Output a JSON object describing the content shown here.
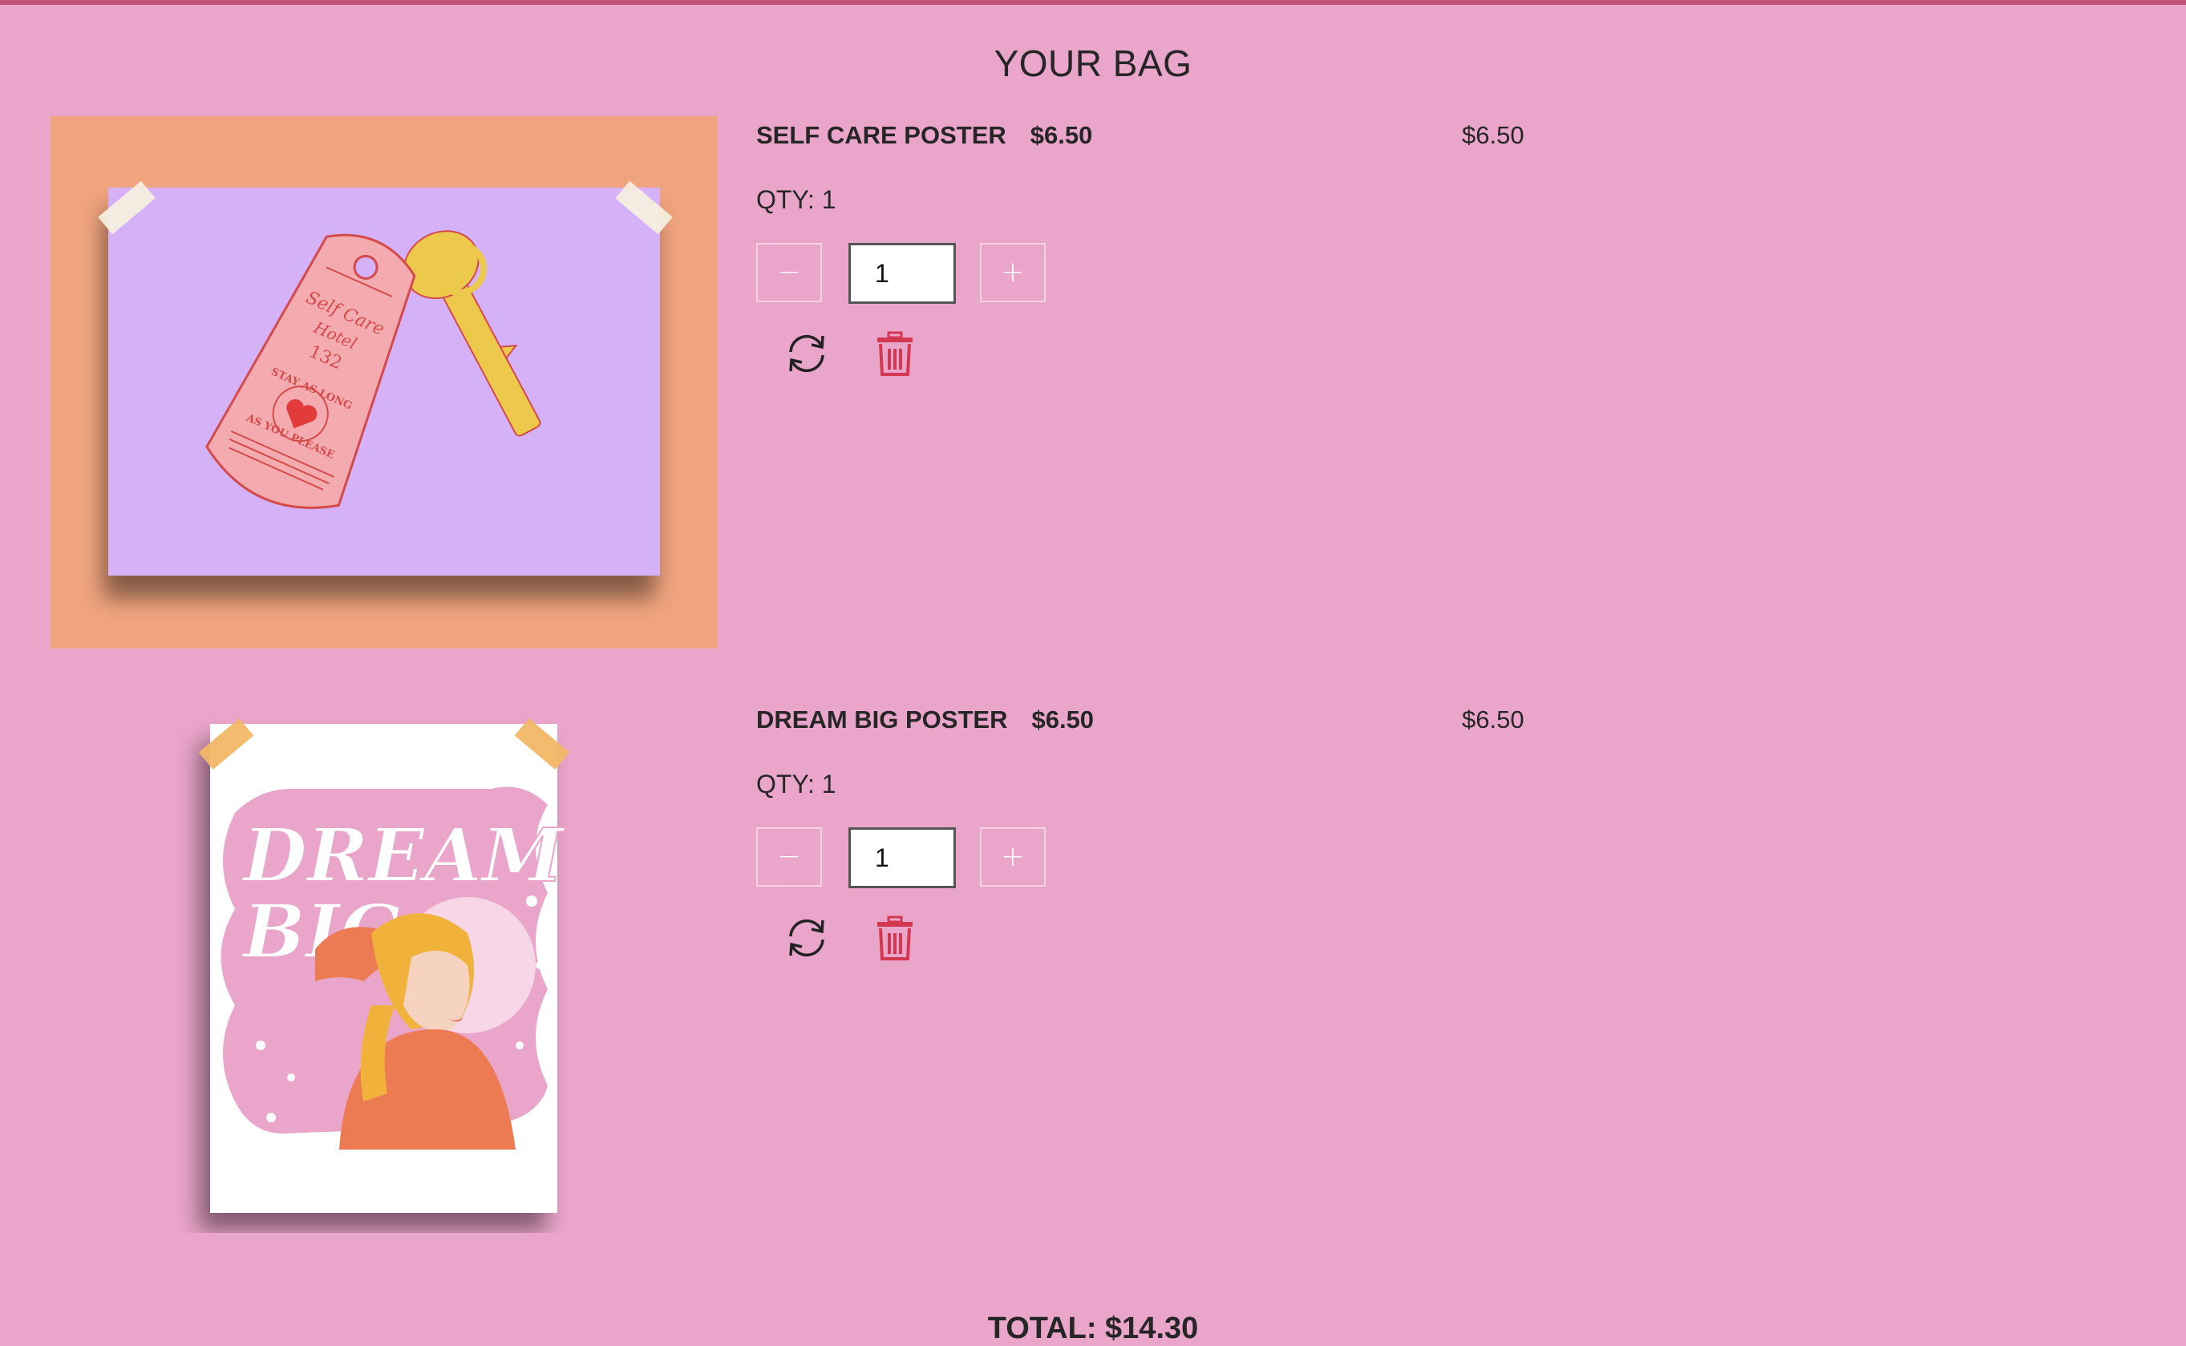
{
  "page": {
    "title": "YOUR BAG",
    "total": "TOTAL: $14.30"
  },
  "colors": {
    "background": "#eaa5ca",
    "accent_bar": "#c0527a",
    "delete_icon": "#d2384f"
  },
  "items": [
    {
      "name": "SELF CARE POSTER",
      "price": "$6.50",
      "line_total": "$6.50",
      "qty_label": "QTY: 1",
      "qty_value": "1",
      "minus_label": "−",
      "plus_label": "+",
      "image": {
        "keytag_text": [
          "Self Care",
          "Hotel",
          "132",
          "STAY AS LONG",
          "AS YOU PLEASE"
        ]
      }
    },
    {
      "name": "DREAM BIG POSTER",
      "price": "$6.50",
      "line_total": "$6.50",
      "qty_label": "QTY: 1",
      "qty_value": "1",
      "minus_label": "−",
      "plus_label": "+",
      "image": {
        "poster_text": [
          "DREAM",
          "BIG"
        ]
      }
    }
  ],
  "icons": {
    "refresh": "refresh-icon",
    "delete": "trash-icon"
  }
}
